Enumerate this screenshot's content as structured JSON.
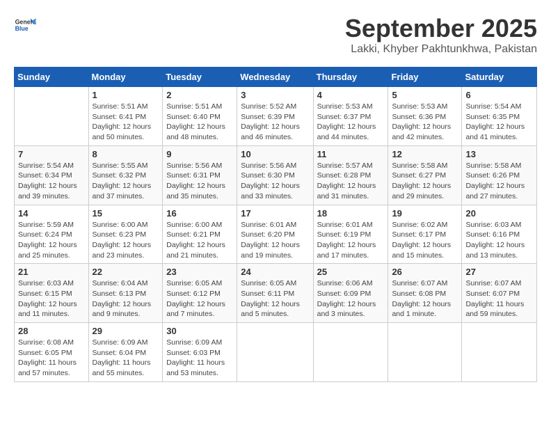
{
  "header": {
    "logo_line1": "General",
    "logo_line2": "Blue",
    "month_year": "September 2025",
    "location": "Lakki, Khyber Pakhtunkhwa, Pakistan"
  },
  "columns": [
    "Sunday",
    "Monday",
    "Tuesday",
    "Wednesday",
    "Thursday",
    "Friday",
    "Saturday"
  ],
  "weeks": [
    [
      {
        "day": "",
        "sunrise": "",
        "sunset": "",
        "daylight": ""
      },
      {
        "day": "1",
        "sunrise": "Sunrise: 5:51 AM",
        "sunset": "Sunset: 6:41 PM",
        "daylight": "Daylight: 12 hours and 50 minutes."
      },
      {
        "day": "2",
        "sunrise": "Sunrise: 5:51 AM",
        "sunset": "Sunset: 6:40 PM",
        "daylight": "Daylight: 12 hours and 48 minutes."
      },
      {
        "day": "3",
        "sunrise": "Sunrise: 5:52 AM",
        "sunset": "Sunset: 6:39 PM",
        "daylight": "Daylight: 12 hours and 46 minutes."
      },
      {
        "day": "4",
        "sunrise": "Sunrise: 5:53 AM",
        "sunset": "Sunset: 6:37 PM",
        "daylight": "Daylight: 12 hours and 44 minutes."
      },
      {
        "day": "5",
        "sunrise": "Sunrise: 5:53 AM",
        "sunset": "Sunset: 6:36 PM",
        "daylight": "Daylight: 12 hours and 42 minutes."
      },
      {
        "day": "6",
        "sunrise": "Sunrise: 5:54 AM",
        "sunset": "Sunset: 6:35 PM",
        "daylight": "Daylight: 12 hours and 41 minutes."
      }
    ],
    [
      {
        "day": "7",
        "sunrise": "Sunrise: 5:54 AM",
        "sunset": "Sunset: 6:34 PM",
        "daylight": "Daylight: 12 hours and 39 minutes."
      },
      {
        "day": "8",
        "sunrise": "Sunrise: 5:55 AM",
        "sunset": "Sunset: 6:32 PM",
        "daylight": "Daylight: 12 hours and 37 minutes."
      },
      {
        "day": "9",
        "sunrise": "Sunrise: 5:56 AM",
        "sunset": "Sunset: 6:31 PM",
        "daylight": "Daylight: 12 hours and 35 minutes."
      },
      {
        "day": "10",
        "sunrise": "Sunrise: 5:56 AM",
        "sunset": "Sunset: 6:30 PM",
        "daylight": "Daylight: 12 hours and 33 minutes."
      },
      {
        "day": "11",
        "sunrise": "Sunrise: 5:57 AM",
        "sunset": "Sunset: 6:28 PM",
        "daylight": "Daylight: 12 hours and 31 minutes."
      },
      {
        "day": "12",
        "sunrise": "Sunrise: 5:58 AM",
        "sunset": "Sunset: 6:27 PM",
        "daylight": "Daylight: 12 hours and 29 minutes."
      },
      {
        "day": "13",
        "sunrise": "Sunrise: 5:58 AM",
        "sunset": "Sunset: 6:26 PM",
        "daylight": "Daylight: 12 hours and 27 minutes."
      }
    ],
    [
      {
        "day": "14",
        "sunrise": "Sunrise: 5:59 AM",
        "sunset": "Sunset: 6:24 PM",
        "daylight": "Daylight: 12 hours and 25 minutes."
      },
      {
        "day": "15",
        "sunrise": "Sunrise: 6:00 AM",
        "sunset": "Sunset: 6:23 PM",
        "daylight": "Daylight: 12 hours and 23 minutes."
      },
      {
        "day": "16",
        "sunrise": "Sunrise: 6:00 AM",
        "sunset": "Sunset: 6:21 PM",
        "daylight": "Daylight: 12 hours and 21 minutes."
      },
      {
        "day": "17",
        "sunrise": "Sunrise: 6:01 AM",
        "sunset": "Sunset: 6:20 PM",
        "daylight": "Daylight: 12 hours and 19 minutes."
      },
      {
        "day": "18",
        "sunrise": "Sunrise: 6:01 AM",
        "sunset": "Sunset: 6:19 PM",
        "daylight": "Daylight: 12 hours and 17 minutes."
      },
      {
        "day": "19",
        "sunrise": "Sunrise: 6:02 AM",
        "sunset": "Sunset: 6:17 PM",
        "daylight": "Daylight: 12 hours and 15 minutes."
      },
      {
        "day": "20",
        "sunrise": "Sunrise: 6:03 AM",
        "sunset": "Sunset: 6:16 PM",
        "daylight": "Daylight: 12 hours and 13 minutes."
      }
    ],
    [
      {
        "day": "21",
        "sunrise": "Sunrise: 6:03 AM",
        "sunset": "Sunset: 6:15 PM",
        "daylight": "Daylight: 12 hours and 11 minutes."
      },
      {
        "day": "22",
        "sunrise": "Sunrise: 6:04 AM",
        "sunset": "Sunset: 6:13 PM",
        "daylight": "Daylight: 12 hours and 9 minutes."
      },
      {
        "day": "23",
        "sunrise": "Sunrise: 6:05 AM",
        "sunset": "Sunset: 6:12 PM",
        "daylight": "Daylight: 12 hours and 7 minutes."
      },
      {
        "day": "24",
        "sunrise": "Sunrise: 6:05 AM",
        "sunset": "Sunset: 6:11 PM",
        "daylight": "Daylight: 12 hours and 5 minutes."
      },
      {
        "day": "25",
        "sunrise": "Sunrise: 6:06 AM",
        "sunset": "Sunset: 6:09 PM",
        "daylight": "Daylight: 12 hours and 3 minutes."
      },
      {
        "day": "26",
        "sunrise": "Sunrise: 6:07 AM",
        "sunset": "Sunset: 6:08 PM",
        "daylight": "Daylight: 12 hours and 1 minute."
      },
      {
        "day": "27",
        "sunrise": "Sunrise: 6:07 AM",
        "sunset": "Sunset: 6:07 PM",
        "daylight": "Daylight: 11 hours and 59 minutes."
      }
    ],
    [
      {
        "day": "28",
        "sunrise": "Sunrise: 6:08 AM",
        "sunset": "Sunset: 6:05 PM",
        "daylight": "Daylight: 11 hours and 57 minutes."
      },
      {
        "day": "29",
        "sunrise": "Sunrise: 6:09 AM",
        "sunset": "Sunset: 6:04 PM",
        "daylight": "Daylight: 11 hours and 55 minutes."
      },
      {
        "day": "30",
        "sunrise": "Sunrise: 6:09 AM",
        "sunset": "Sunset: 6:03 PM",
        "daylight": "Daylight: 11 hours and 53 minutes."
      },
      {
        "day": "",
        "sunrise": "",
        "sunset": "",
        "daylight": ""
      },
      {
        "day": "",
        "sunrise": "",
        "sunset": "",
        "daylight": ""
      },
      {
        "day": "",
        "sunrise": "",
        "sunset": "",
        "daylight": ""
      },
      {
        "day": "",
        "sunrise": "",
        "sunset": "",
        "daylight": ""
      }
    ]
  ]
}
